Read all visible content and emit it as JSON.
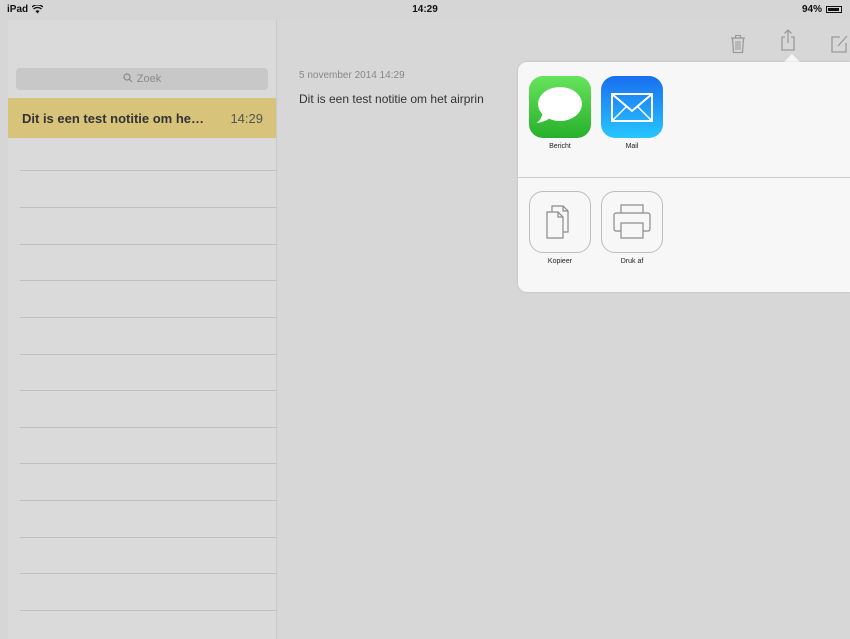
{
  "status": {
    "device": "iPad",
    "time": "14:29",
    "battery": "94%",
    "battery_level": 0.94
  },
  "sidebar": {
    "search_placeholder": "Zoek",
    "notes": [
      {
        "title": "Dit is een test notitie om he…",
        "time": "14:29"
      }
    ]
  },
  "main": {
    "date": "5 november 2014 14:29",
    "text": "Dit is een test notitie om het airprin"
  },
  "share": {
    "apps": [
      {
        "label": "Bericht",
        "icon": "messages-icon",
        "color": "#3cc93a"
      },
      {
        "label": "Mail",
        "icon": "mail-icon",
        "color": "#1e88f5"
      }
    ],
    "actions": [
      {
        "label": "Kopieer",
        "icon": "copy-icon"
      },
      {
        "label": "Druk af",
        "icon": "print-icon"
      }
    ]
  },
  "toolbar": {
    "icons": [
      "trash-icon",
      "share-icon",
      "compose-icon"
    ]
  }
}
